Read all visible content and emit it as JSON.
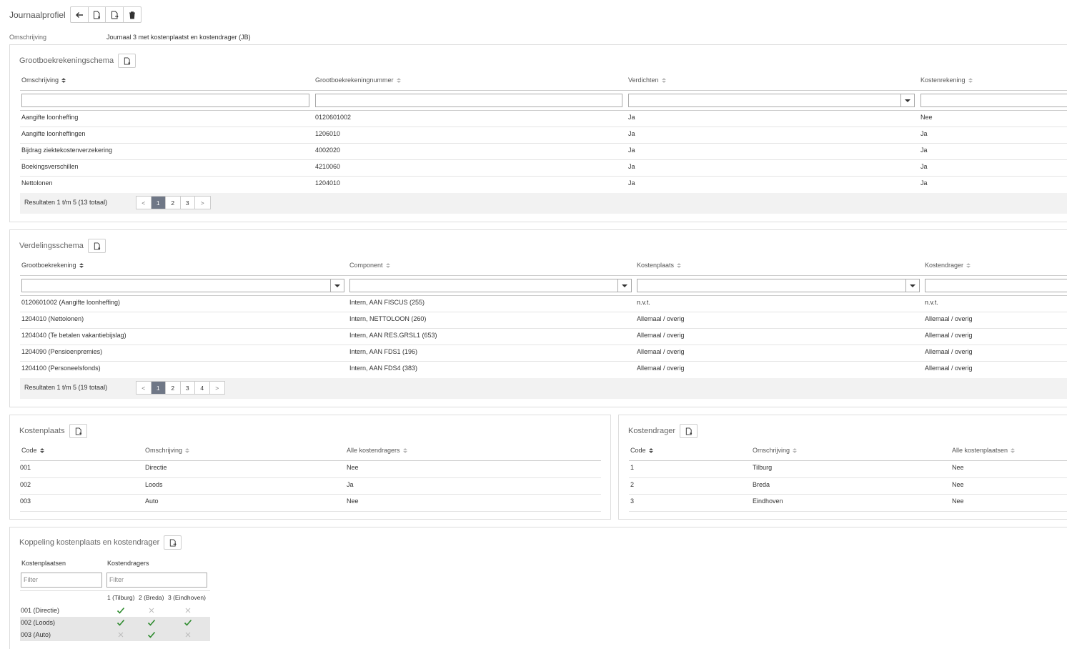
{
  "page": {
    "title": "Journaalprofiel",
    "omschrijving_label": "Omschrijving",
    "omschrijving_value": "Journaal 3 met kostenplaatst en kostendrager (JB)"
  },
  "toolbar": {
    "icons": [
      "arrow-left-icon",
      "add-document-icon",
      "export-document-icon",
      "trash-icon"
    ]
  },
  "grootboek": {
    "title": "Grootboekrekeningschema",
    "columns": [
      "Omschrijving",
      "Grootboekrekeningnummer",
      "Verdichten",
      "Kostenrekening"
    ],
    "rows": [
      [
        "Aangifte loonheffing",
        "0120601002",
        "Ja",
        "Nee"
      ],
      [
        "Aangifte loonheffingen",
        "1206010",
        "Ja",
        "Ja"
      ],
      [
        "Bijdrag ziektekostenverzekering",
        "4002020",
        "Ja",
        "Ja"
      ],
      [
        "Boekingsverschillen",
        "4210060",
        "Ja",
        "Ja"
      ],
      [
        "Nettolonen",
        "1204010",
        "Ja",
        "Ja"
      ]
    ],
    "results": "Resultaten 1 t/m 5 (13 totaal)",
    "pages": [
      "<",
      "1",
      "2",
      "3",
      ">"
    ]
  },
  "verdeling": {
    "title": "Verdelingsschema",
    "columns": [
      "Grootboekrekening",
      "Component",
      "Kostenplaats",
      "Kostendrager"
    ],
    "rows": [
      [
        "0120601002 (Aangifte loonheffing)",
        "Intern, AAN FISCUS (255)",
        "n.v.t.",
        "n.v.t."
      ],
      [
        "1204010 (Nettolonen)",
        "Intern, NETTOLOON (260)",
        "Allemaal / overig",
        "Allemaal / overig"
      ],
      [
        "1204040 (Te betalen vakantiebijslag)",
        "Intern, AAN RES.GRSL1 (653)",
        "Allemaal / overig",
        "Allemaal / overig"
      ],
      [
        "1204090 (Pensioenpremies)",
        "Intern, AAN FDS1 (196)",
        "Allemaal / overig",
        "Allemaal / overig"
      ],
      [
        "1204100 (Personeelsfonds)",
        "Intern, AAN FDS4 (383)",
        "Allemaal / overig",
        "Allemaal / overig"
      ]
    ],
    "results": "Resultaten 1 t/m 5 (19 totaal)",
    "pages": [
      "<",
      "1",
      "2",
      "3",
      "4",
      ">"
    ]
  },
  "kostenplaats": {
    "title": "Kostenplaats",
    "columns": [
      "Code",
      "Omschrijving",
      "Alle kostendragers"
    ],
    "rows": [
      [
        "001",
        "Directie",
        "Nee"
      ],
      [
        "002",
        "Loods",
        "Ja"
      ],
      [
        "003",
        "Auto",
        "Nee"
      ]
    ]
  },
  "kostendrager": {
    "title": "Kostendrager",
    "columns": [
      "Code",
      "Omschrijving",
      "Alle kostenplaatsen"
    ],
    "rows": [
      [
        "1",
        "Tilburg",
        "Nee"
      ],
      [
        "2",
        "Breda",
        "Nee"
      ],
      [
        "3",
        "Eindhoven",
        "Nee"
      ]
    ]
  },
  "koppeling": {
    "title": "Koppeling kostenplaats en kostendrager",
    "col1_label": "Kostenplaatsen",
    "col2_label": "Kostendragers",
    "filter_placeholder": "Filter",
    "drager_headers": [
      "1 (Tilburg)",
      "2 (Breda)",
      "3 (Eindhoven)"
    ],
    "rows": [
      {
        "label": "001 (Directie)",
        "values": [
          true,
          false,
          false
        ]
      },
      {
        "label": "002 (Loods)",
        "values": [
          true,
          true,
          true
        ]
      },
      {
        "label": "003 (Auto)",
        "values": [
          false,
          true,
          false
        ]
      }
    ],
    "colors": {
      "check": "#2e8b2e",
      "cross": "#bbbbbb"
    }
  },
  "colors": {
    "active_page": "#6f7786"
  }
}
